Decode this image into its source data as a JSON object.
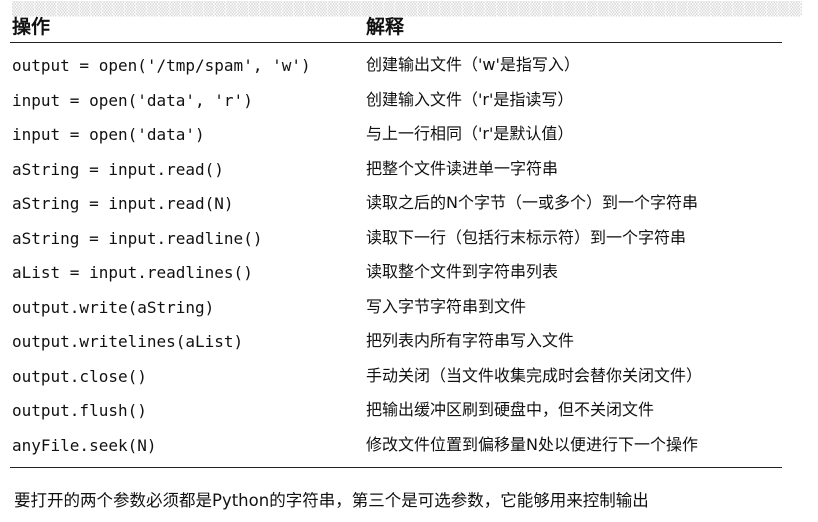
{
  "table": {
    "header": {
      "operation": "操作",
      "description": "解释"
    },
    "rows": [
      {
        "op": "output = open('/tmp/spam', 'w')",
        "desc": "创建输出文件（'w'是指写入）"
      },
      {
        "op": "input = open('data', 'r')",
        "desc": "创建输入文件（'r'是指读写）"
      },
      {
        "op": "input = open('data')",
        "desc": "与上一行相同（'r'是默认值）"
      },
      {
        "op": "aString = input.read()",
        "desc": "把整个文件读进单一字符串"
      },
      {
        "op": "aString = input.read(N)",
        "desc": "读取之后的N个字节（一或多个）到一个字符串"
      },
      {
        "op": "aString = input.readline()",
        "desc": "读取下一行（包括行末标示符）到一个字符串"
      },
      {
        "op": "aList = input.readlines()",
        "desc": "读取整个文件到字符串列表"
      },
      {
        "op": "output.write(aString)",
        "desc": "写入字节字符串到文件"
      },
      {
        "op": "output.writelines(aList)",
        "desc": "把列表内所有字符串写入文件"
      },
      {
        "op": "output.close()",
        "desc": "手动关闭（当文件收集完成时会替你关闭文件）"
      },
      {
        "op": "output.flush()",
        "desc": "把输出缓冲区刷到硬盘中，但不关闭文件"
      },
      {
        "op": "anyFile.seek(N)",
        "desc": "修改文件位置到偏移量N处以便进行下一个操作"
      }
    ]
  },
  "note": "要打开的两个参数必须都是Python的字符串，第三个是可选参数，它能够用来控制输出"
}
